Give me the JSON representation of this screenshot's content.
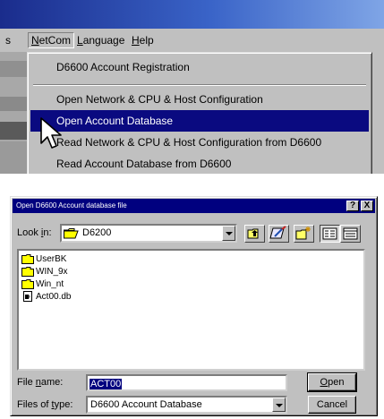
{
  "menubar": {
    "items": [
      {
        "label": "s",
        "accel": ""
      },
      {
        "label": "NetCom",
        "accel": "N"
      },
      {
        "label": "Language",
        "accel": "L"
      },
      {
        "label": "Help",
        "accel": "H"
      }
    ]
  },
  "netcom_menu": {
    "items": [
      {
        "label": "D6600 Account Registration",
        "highlighted": false
      },
      {
        "label": "Open Network & CPU & Host Configuration",
        "highlighted": false
      },
      {
        "label": "Open Account Database",
        "highlighted": true
      },
      {
        "label": "Read Network & CPU & Host Configuration from D6600",
        "highlighted": false
      },
      {
        "label": "Read Account Database from D6600",
        "highlighted": false
      }
    ]
  },
  "dialog": {
    "title": "Open D6600 Account database file",
    "look_in_label": "Look in:",
    "look_in_value": "D6200",
    "files": [
      {
        "name": "UserBK",
        "icon": "folder-icon"
      },
      {
        "name": "WIN_9x",
        "icon": "folder-icon"
      },
      {
        "name": "Win_nt",
        "icon": "folder-icon"
      },
      {
        "name": "Act00.db",
        "icon": "file-icon"
      }
    ],
    "file_name_label": "File name:",
    "file_name_value": "ACT00",
    "files_of_type_label": "Files of type:",
    "files_of_type_value": "D6600 Account Database",
    "open_button": "Open",
    "cancel_button": "Cancel",
    "help_button": "?",
    "close_button": "X"
  },
  "colors": {
    "menu_highlight": "#0a0a80",
    "dialog_titlebar": "#00007f",
    "window_face": "#c0c0c0"
  }
}
